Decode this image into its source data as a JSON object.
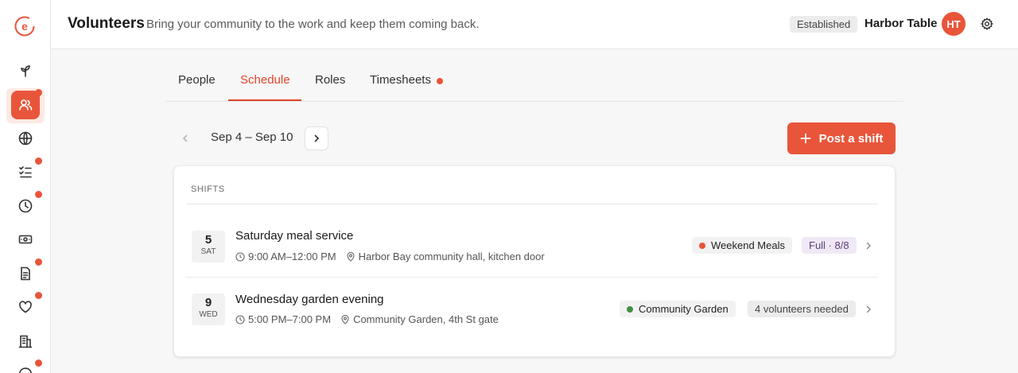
{
  "header": {
    "title": "Volunteers",
    "subtitle": "Bring your community to the work and keep them coming back.",
    "badge": "Established",
    "org_name": "Harbor Table",
    "avatar_initials": "HT"
  },
  "sidebar": {
    "items": [
      {
        "icon": "sprout-icon",
        "dot": false
      },
      {
        "icon": "people-icon",
        "dot": true,
        "active": true
      },
      {
        "icon": "globe-icon",
        "dot": false
      },
      {
        "icon": "checklist-icon",
        "dot": true
      },
      {
        "icon": "clock-icon",
        "dot": true
      },
      {
        "icon": "money-icon",
        "dot": false
      },
      {
        "icon": "document-icon",
        "dot": true
      },
      {
        "icon": "heart-icon",
        "dot": true
      },
      {
        "icon": "building-icon",
        "dot": false
      },
      {
        "icon": "chat-icon",
        "dot": true
      }
    ]
  },
  "tabs": [
    {
      "label": "People",
      "active": false
    },
    {
      "label": "Schedule",
      "active": true
    },
    {
      "label": "Roles",
      "active": false
    },
    {
      "label": "Timesheets",
      "active": false,
      "dot": true
    }
  ],
  "toolbar": {
    "date_range": "Sep 4 – Sep 10",
    "post_label": "Post a shift"
  },
  "shifts": {
    "section_label": "SHIFTS",
    "items": [
      {
        "day": "5",
        "dow": "SAT",
        "title": "Saturday meal service",
        "time": "9:00 AM–12:00 PM",
        "location": "Harbor Bay community hall, kitchen door",
        "program": "Weekend Meals",
        "program_color": "#e8553a",
        "status": "Full · 8/8"
      },
      {
        "day": "9",
        "dow": "WED",
        "title": "Wednesday garden evening",
        "time": "5:00 PM–7:00 PM",
        "location": "Community Garden, 4th St gate",
        "program": "Community Garden",
        "program_color": "#3f9142",
        "status": "4 volunteers needed"
      }
    ]
  },
  "colors": {
    "accent": "#e8553a",
    "tab_active": "#e0452b"
  }
}
